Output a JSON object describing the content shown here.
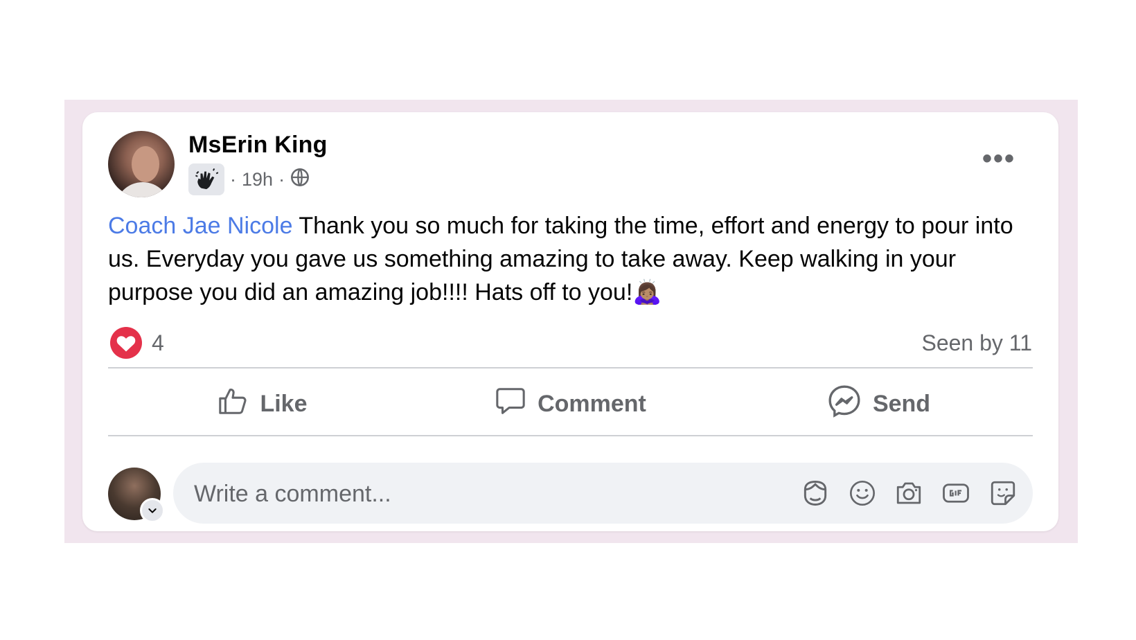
{
  "post": {
    "author": "MsErin King",
    "badge_icon": "waving-hand-icon",
    "separator": "·",
    "time": "19h",
    "audience_icon": "globe-icon",
    "more_label": "•••",
    "mention": "Coach Jae Nicole",
    "body": " Thank you so much for taking the time, effort and energy to pour into us. Everyday you gave us something amazing to take away. Keep walking in your purpose you did an amazing job!!!! Hats off to you!",
    "body_emoji": "🙇🏽‍♀️"
  },
  "reactions": {
    "icon": "heart-reaction-icon",
    "count": "4",
    "seen_by": "Seen by 11"
  },
  "actions": {
    "like": "Like",
    "comment": "Comment",
    "send": "Send"
  },
  "comment_box": {
    "placeholder": "Write a comment...",
    "icons": [
      "avatar-sticker-icon",
      "emoji-icon",
      "camera-icon",
      "gif-icon",
      "sticker-icon"
    ]
  },
  "colors": {
    "mention": "#4c7be6",
    "frame_background": "#f1e5ee",
    "heart": "#e4314a",
    "secondary_text": "#65676b"
  }
}
